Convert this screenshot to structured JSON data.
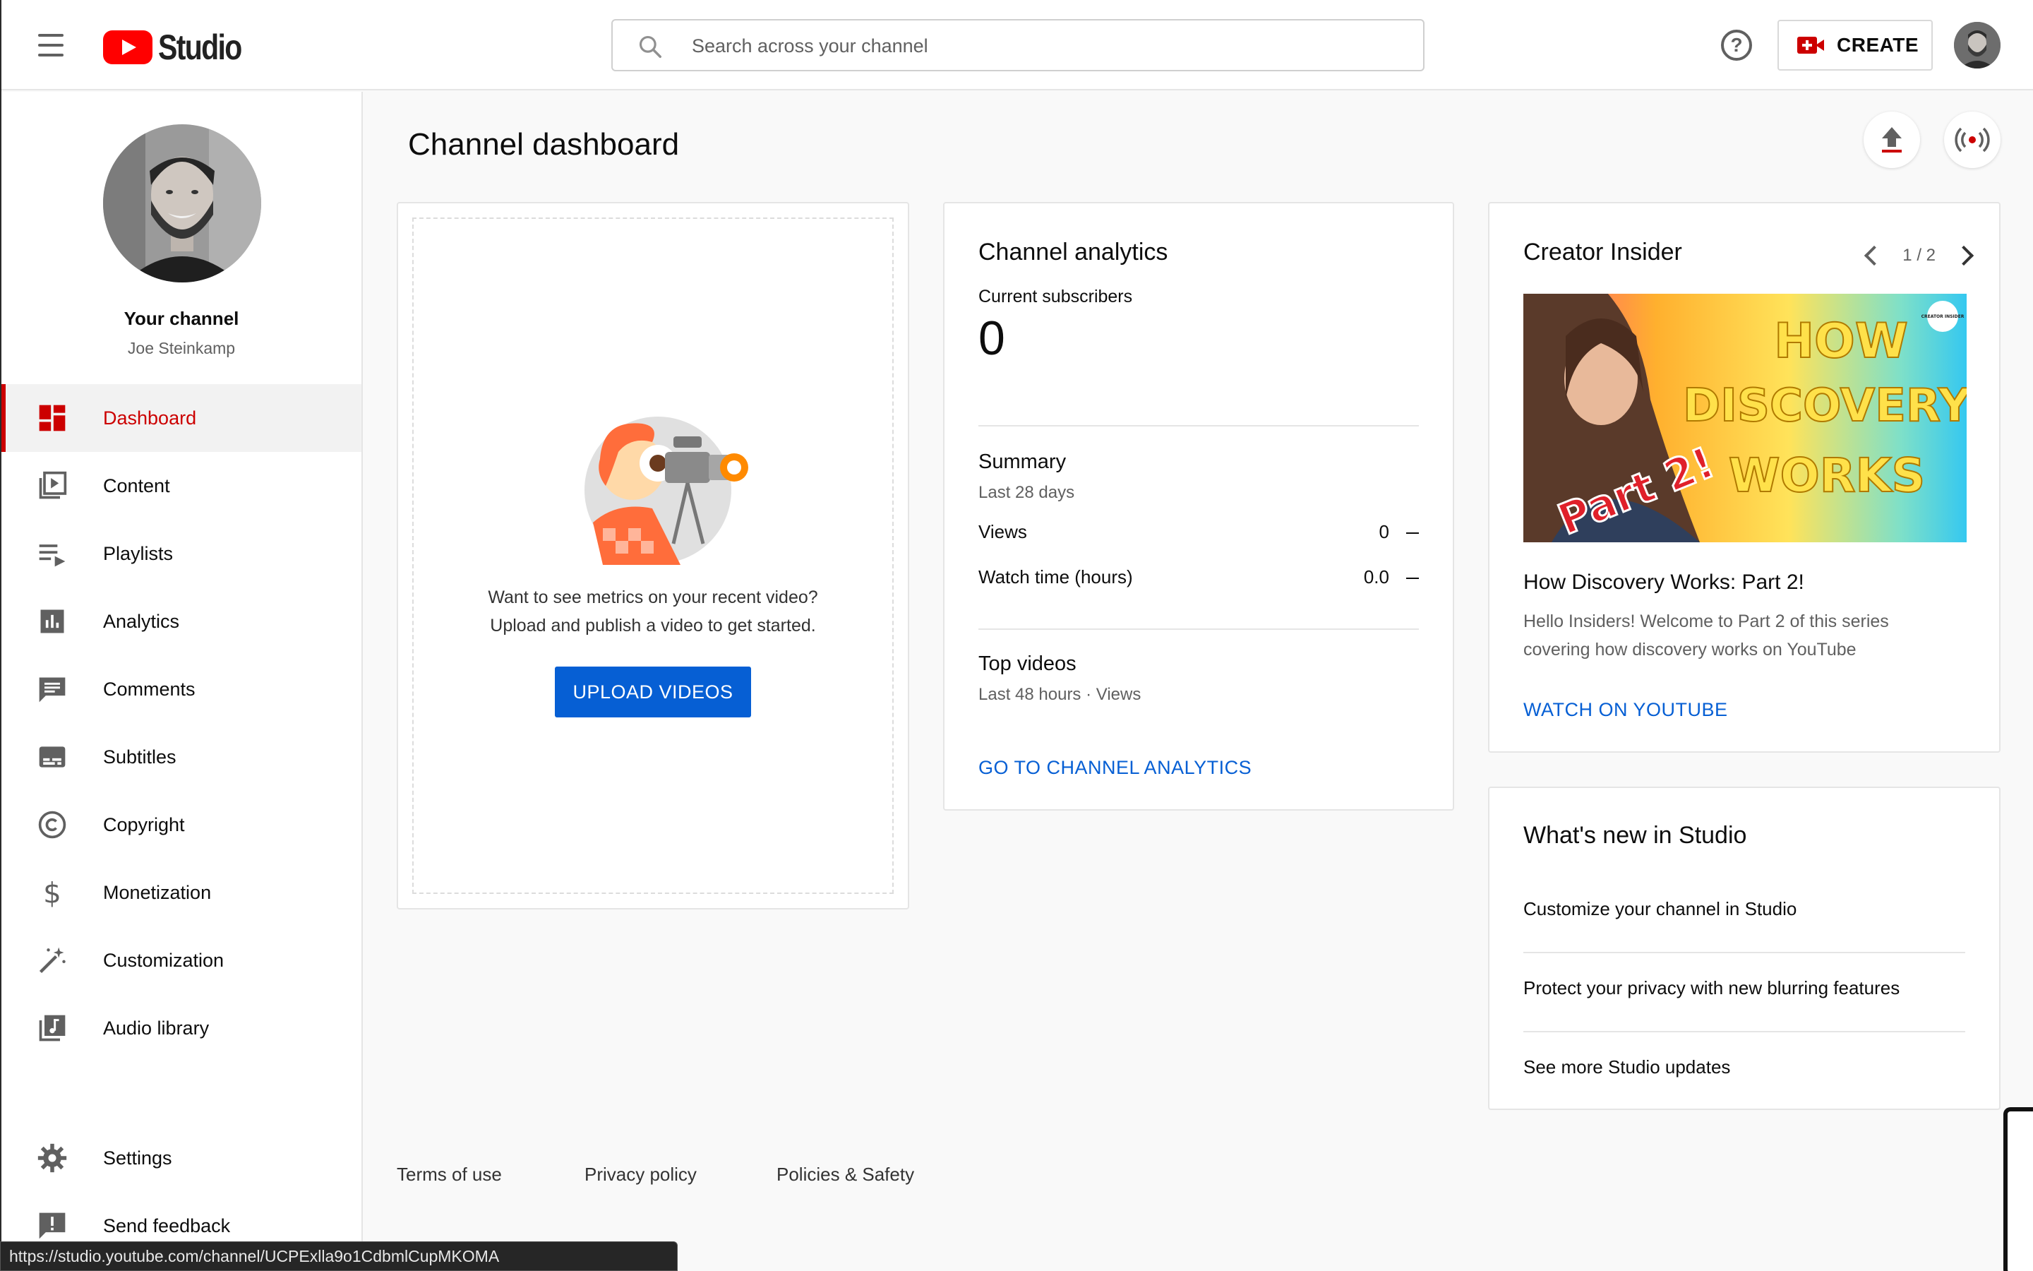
{
  "header": {
    "logo_text": "Studio",
    "search_placeholder": "Search across your channel",
    "help_glyph": "?",
    "create_label": "CREATE"
  },
  "sidebar": {
    "your_channel": "Your channel",
    "channel_name": "Joe Steinkamp",
    "items": [
      {
        "label": "Dashboard",
        "icon": "dashboard-icon"
      },
      {
        "label": "Content",
        "icon": "content-icon"
      },
      {
        "label": "Playlists",
        "icon": "playlists-icon"
      },
      {
        "label": "Analytics",
        "icon": "analytics-icon"
      },
      {
        "label": "Comments",
        "icon": "comments-icon"
      },
      {
        "label": "Subtitles",
        "icon": "subtitles-icon"
      },
      {
        "label": "Copyright",
        "icon": "copyright-icon"
      },
      {
        "label": "Monetization",
        "icon": "monetization-icon"
      },
      {
        "label": "Customization",
        "icon": "customization-icon"
      },
      {
        "label": "Audio library",
        "icon": "audio-library-icon"
      }
    ],
    "settings": "Settings",
    "send_feedback": "Send feedback"
  },
  "main": {
    "title": "Channel dashboard",
    "upload_card": {
      "message_line1": "Want to see metrics on your recent video?",
      "message_line2": "Upload and publish a video to get started.",
      "button": "UPLOAD VIDEOS"
    },
    "analytics_card": {
      "title": "Channel analytics",
      "subscribers_label": "Current subscribers",
      "subscribers_value": "0",
      "summary_title": "Summary",
      "summary_period": "Last 28 days",
      "metrics": [
        {
          "label": "Views",
          "value": "0"
        },
        {
          "label": "Watch time (hours)",
          "value": "0.0"
        }
      ],
      "top_videos_title": "Top videos",
      "top_videos_period": "Last 48 hours · Views",
      "link": "GO TO CHANNEL ANALYTICS"
    },
    "insider_card": {
      "title": "Creator Insider",
      "pager": "1 / 2",
      "thumb_text": [
        "HOW",
        "DISCOVERY",
        "WORKS"
      ],
      "thumb_part": "Part 2!",
      "thumb_badge": "CREATOR INSIDER",
      "video_title": "How Discovery Works: Part 2!",
      "video_desc": "Hello Insiders! Welcome to Part 2 of this series covering how discovery works on YouTube",
      "link": "WATCH ON YOUTUBE"
    },
    "news_card": {
      "title": "What's new in Studio",
      "items": [
        "Customize your channel in Studio",
        "Protect your privacy with new blurring features",
        "See more Studio updates"
      ]
    }
  },
  "footer": {
    "links": [
      "Terms of use",
      "Privacy policy",
      "Policies & Safety"
    ]
  },
  "status_bar": {
    "url": "https://studio.youtube.com/channel/UCPExlla9o1CdbmlCupMKOMA"
  },
  "colors": {
    "accent_red": "#cc0000",
    "link_blue": "#065fd4"
  }
}
